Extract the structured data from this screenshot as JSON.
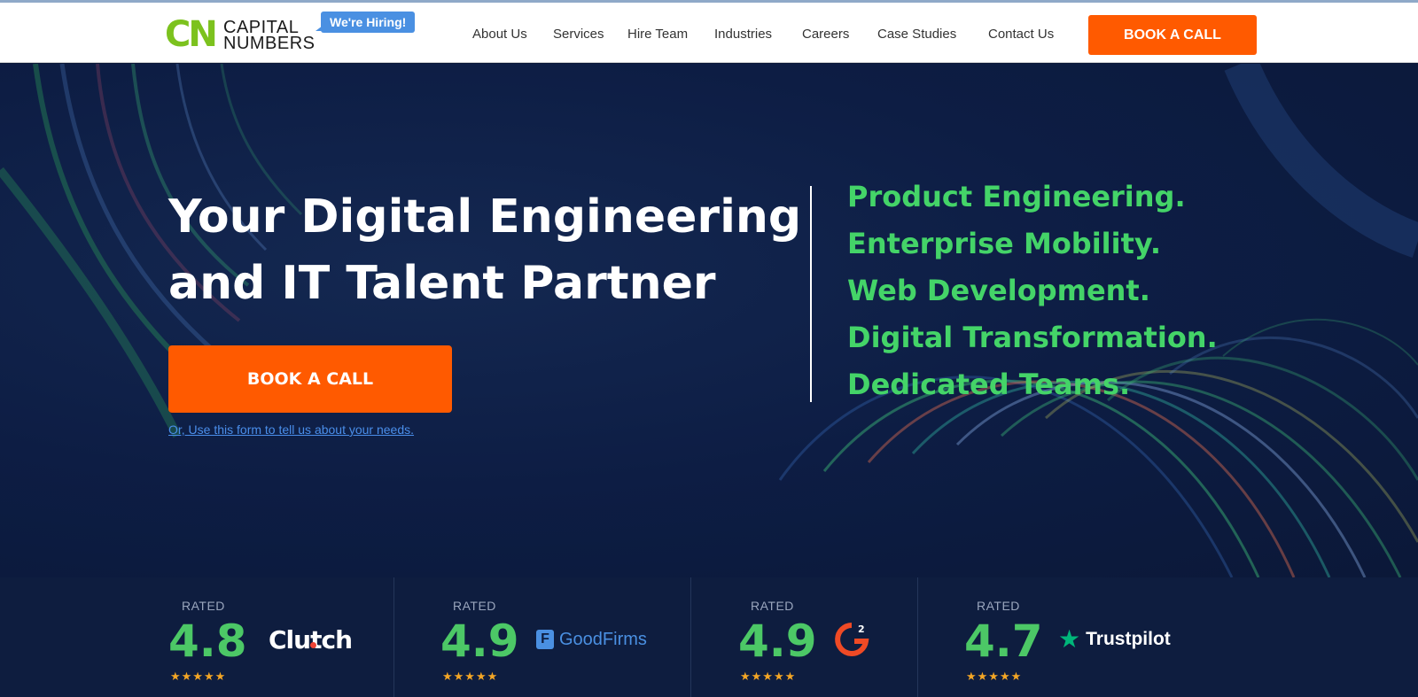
{
  "header": {
    "logo": {
      "mark": "CN",
      "line1": "CAPITAL",
      "line2": "NUMBERS"
    },
    "hiring_badge": "We're Hiring!",
    "nav": [
      "About Us",
      "Services",
      "Hire Team",
      "Industries",
      "Careers",
      "Case Studies",
      "Contact Us"
    ],
    "cta": "BOOK A CALL"
  },
  "hero": {
    "headline": [
      "Your Digital Engineering",
      "and IT Talent Partner"
    ],
    "cta": "BOOK A CALL",
    "form_link": "Or, Use this form to tell us about your needs.",
    "services": [
      "Product Engineering.",
      "Enterprise Mobility.",
      "Web Development.",
      "Digital Transformation.",
      "Dedicated Teams."
    ]
  },
  "ratings": [
    {
      "label": "RATED",
      "score": "4.8",
      "brand": "Clutch",
      "stars": "★★★★★"
    },
    {
      "label": "RATED",
      "score": "4.9",
      "brand": "GoodFirms",
      "stars": "★★★★★"
    },
    {
      "label": "RATED",
      "score": "4.9",
      "brand": "G2",
      "stars": "★★★★★"
    },
    {
      "label": "RATED",
      "score": "4.7",
      "brand": "Trustpilot",
      "stars": "★★★★★"
    }
  ],
  "colors": {
    "accent_orange": "#ff5a00",
    "accent_green": "#44d468",
    "hero_bg": "#0d1d44",
    "link_blue": "#4a8eea",
    "star_gold": "#f4a625"
  }
}
